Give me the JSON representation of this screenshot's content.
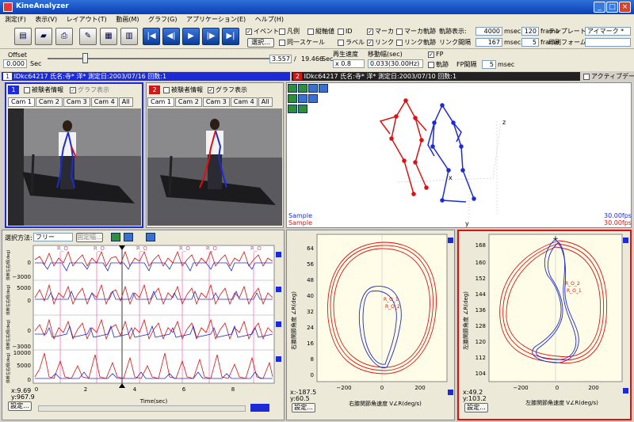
{
  "app": {
    "title": "KineAnalyzer"
  },
  "window_controls": {
    "minimize": "_",
    "maximize": "□",
    "close": "×"
  },
  "menu": [
    "測定(F)",
    "表示(V)",
    "レイアウト(T)",
    "動画(M)",
    "グラフ(G)",
    "アプリケーション(E)",
    "ヘルプ(H)"
  ],
  "toolbar": {
    "event": "イベント",
    "select": "選択...",
    "legend": "凡例",
    "vertical": "縦軸値",
    "same_scale": "同一スケール",
    "id": "ID",
    "label": "ラベル",
    "marker": "マーカ",
    "link": "リンク",
    "marker_trace": "マーカ軌跡",
    "link_trace": "リンク軌跡",
    "trace_display": "軌跡表示:",
    "trace_value": "4000",
    "msec": "msec",
    "frame_count": "120",
    "frame": "frame",
    "link_interval": "リンク間隔",
    "link_interval_value": "167",
    "link_frame_value": "5",
    "template": "テンプレート:",
    "template_value": "アイマーク *",
    "print_form": "印刷フォーム:"
  },
  "offset": {
    "label": "Offset",
    "value": "0.000",
    "unit": "Sec",
    "current": "3.557",
    "sep": "/",
    "total": "19.466",
    "total_unit": "Sec",
    "speed_label": "再生速度",
    "speed_value": "x 0.8",
    "move_label": "移動幅(sec)",
    "move_value": "0.033(30.00Hz)",
    "fp": "FP",
    "trace": "軌跡",
    "fp_interval": "FP間隔",
    "fp_value": "5",
    "fp_unit": "msec"
  },
  "datasets": [
    {
      "num": "1",
      "text": "IDkc64217 氏名:寺* 洋* 測定日:2003/07/16 回数:1",
      "color": "#1c2bd6"
    },
    {
      "num": "2",
      "text": "IDkc64217 氏名:寺* 洋* 測定日:2003/07/10 回数:1",
      "color": "#cc1a1a"
    }
  ],
  "active_data": "アクティブデータ",
  "video": {
    "subject_info": "被験者情報",
    "graph_display": "グラフ表示",
    "cams": [
      "Cam 1",
      "Cam 2",
      "Cam 3",
      "Cam 4",
      "All"
    ]
  },
  "view3d": {
    "sample1": "Sample",
    "sample2": "Sample",
    "fps1": "30.00fps",
    "fps2": "30.00fps",
    "axis_x": "x",
    "axis_y": "y",
    "axis_z": "z"
  },
  "timeseries": {
    "select_label": "選択方法:",
    "select_value": "フリー",
    "fixed": "固定幅...",
    "event_labels": [
      "R_O",
      "R_O",
      "R_O",
      "R_O",
      "R_O",
      "R_O"
    ],
    "ylabel": "体幹左右傾(deg)",
    "panels": [
      {
        "ticks": [
          "0",
          "−3000"
        ]
      },
      {
        "ticks": [
          "5000",
          "0"
        ]
      },
      {
        "ticks": [
          "0",
          "−3000"
        ]
      },
      {
        "ticks": [
          "10000",
          "5000",
          "0"
        ]
      }
    ],
    "xticks": [
      "0",
      "2",
      "4",
      "6",
      "8"
    ],
    "xlabel": "Time(sec)",
    "xread": "x:9.69",
    "yread": "y:967.9",
    "settings": "設定..."
  },
  "phase1": {
    "yticks": [
      "64",
      "56",
      "48",
      "40",
      "32",
      "24",
      "16",
      "8",
      "0"
    ],
    "xticks": [
      "−200",
      "0",
      "200"
    ],
    "ylabel": "右膝関節角度 ∠R(deg)",
    "xlabel": "右膝関節角速度 V∠R(deg/s)",
    "event_labels": [
      "R_O_1",
      "R_O_2"
    ],
    "xread": "x:-187.5",
    "yread": "y:60.5",
    "settings": "設定..."
  },
  "phase2": {
    "yticks": [
      "168",
      "160",
      "152",
      "144",
      "136",
      "128",
      "120",
      "112",
      "104"
    ],
    "xticks": [
      "−200",
      "0",
      "200"
    ],
    "ylabel": "左膝関節角度 ∠R(deg)",
    "xlabel": "左膝関節角速度 V∠R(deg/s)",
    "event_labels": [
      "R_O_2",
      "R_O_1"
    ],
    "xread": "x:49.2",
    "yread": "y:103.2",
    "settings": "設定..."
  },
  "colors": {
    "blue": "#1c2bd6",
    "red": "#e01010",
    "pink": "#ff40a0",
    "panel_bg": "#fffde8"
  }
}
